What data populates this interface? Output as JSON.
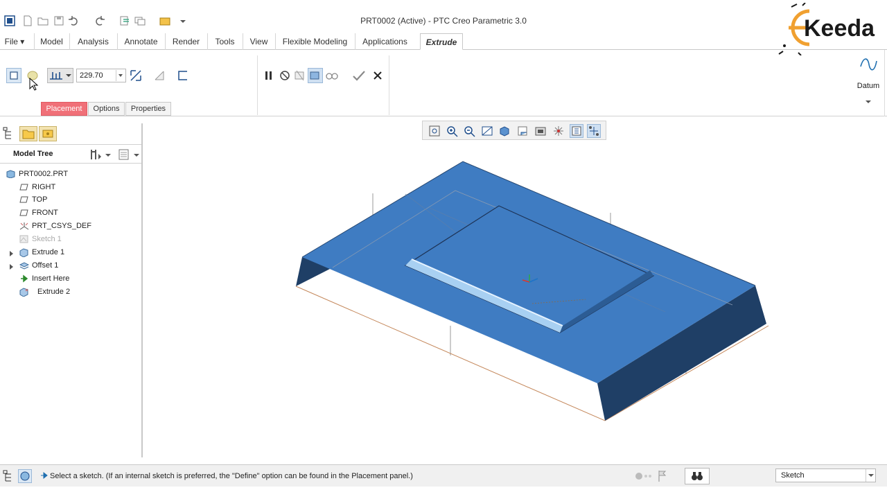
{
  "window": {
    "title": "PRT0002 (Active) - PTC Creo Parametric 3.0"
  },
  "brand": {
    "logo_text": "Keeda"
  },
  "tabs": [
    {
      "label": "File ▾"
    },
    {
      "label": "Model"
    },
    {
      "label": "Analysis"
    },
    {
      "label": "Annotate"
    },
    {
      "label": "Render"
    },
    {
      "label": "Tools"
    },
    {
      "label": "View"
    },
    {
      "label": "Flexible Modeling"
    },
    {
      "label": "Applications"
    },
    {
      "label": "Extrude"
    }
  ],
  "ribbon": {
    "depth_value": "229.70",
    "subtabs": [
      {
        "label": "Placement"
      },
      {
        "label": "Options"
      },
      {
        "label": "Properties"
      }
    ],
    "datum_label": "Datum"
  },
  "model_tree": {
    "title": "Model Tree",
    "items": [
      {
        "label": "PRT0002.PRT",
        "icon": "part-icon"
      },
      {
        "label": "RIGHT",
        "icon": "datum-plane-icon"
      },
      {
        "label": "TOP",
        "icon": "datum-plane-icon"
      },
      {
        "label": "FRONT",
        "icon": "datum-plane-icon"
      },
      {
        "label": "PRT_CSYS_DEF",
        "icon": "csys-icon"
      },
      {
        "label": "Sketch 1",
        "icon": "sketch-icon"
      },
      {
        "label": "Extrude 1",
        "icon": "extrude-icon"
      },
      {
        "label": "Offset 1",
        "icon": "offset-icon"
      },
      {
        "label": "Insert Here",
        "icon": "insert-arrow-icon"
      },
      {
        "label": "Extrude 2",
        "icon": "extrude-icon"
      }
    ]
  },
  "status": {
    "message": "Select a sketch. (If an internal sketch is preferred, the \"Define\" option can be found in the Placement panel.)",
    "filter_value": "Sketch"
  },
  "colors": {
    "model_blue": "#3f7cc2",
    "model_side": "#1f3f66",
    "placement_tab": "#f07078",
    "accent": "#1f4e8c"
  }
}
